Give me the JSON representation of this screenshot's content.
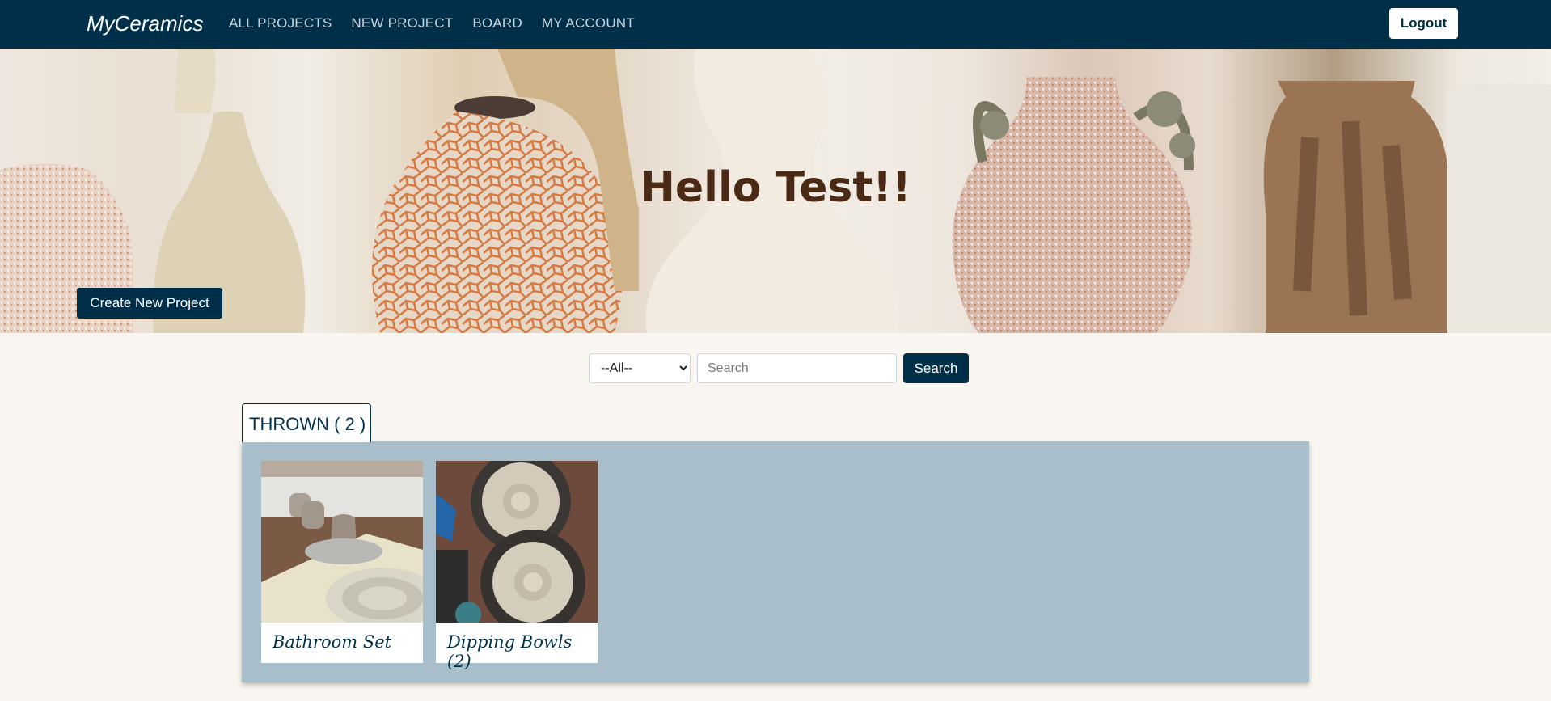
{
  "nav": {
    "brand": "MyCeramics",
    "links": [
      "ALL PROJECTS",
      "NEW PROJECT",
      "BOARD",
      "MY ACCOUNT"
    ],
    "logout_label": "Logout"
  },
  "hero": {
    "title": "Hello Test!!",
    "create_label": "Create New Project"
  },
  "search": {
    "filter_selected": "--All--",
    "placeholder": "Search",
    "button_label": "Search"
  },
  "category": {
    "tab_label": "THROWN ( 2 )",
    "projects": [
      {
        "title": "Bathroom Set"
      },
      {
        "title": "Dipping Bowls (2)"
      }
    ]
  },
  "colors": {
    "navbar": "#003049",
    "panel": "#a8bfcb",
    "page_bg": "#f9f6f1",
    "hero_title": "#4a2a14"
  }
}
